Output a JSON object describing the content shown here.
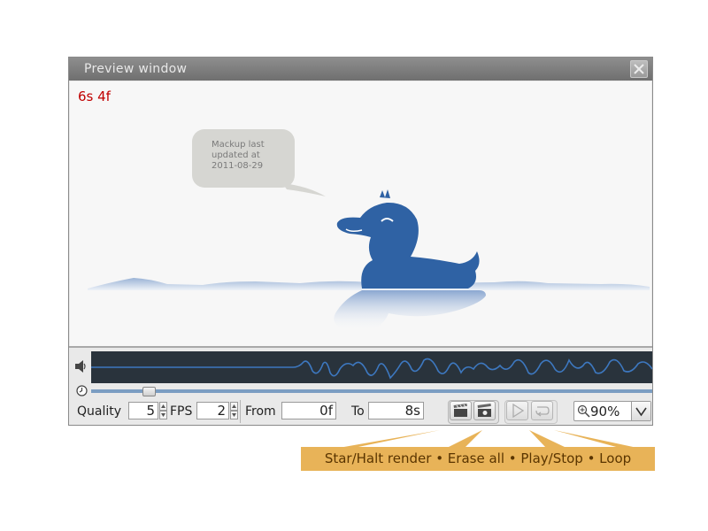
{
  "window": {
    "title": "Preview window"
  },
  "stage": {
    "time_display": "6s 4f",
    "bubble_lines": [
      "Mackup last",
      "updated at",
      "2011-08-29"
    ]
  },
  "controls": {
    "quality_label": "Quality",
    "quality_value": "5",
    "fps_label": "FPS",
    "fps_value": "2",
    "from_label": "From",
    "from_value": "0f",
    "to_label": "To",
    "to_value": "8s",
    "zoom_value": "90%"
  },
  "annotation": {
    "text": "Star/Halt render • Erase all • Play/Stop • Loop"
  },
  "colors": {
    "time_display": "#c00000",
    "duck": "#2f62a4",
    "annotation_bg": "#e8b358",
    "waveform_bg": "#29333c",
    "waveform_line": "#3d78c0"
  }
}
